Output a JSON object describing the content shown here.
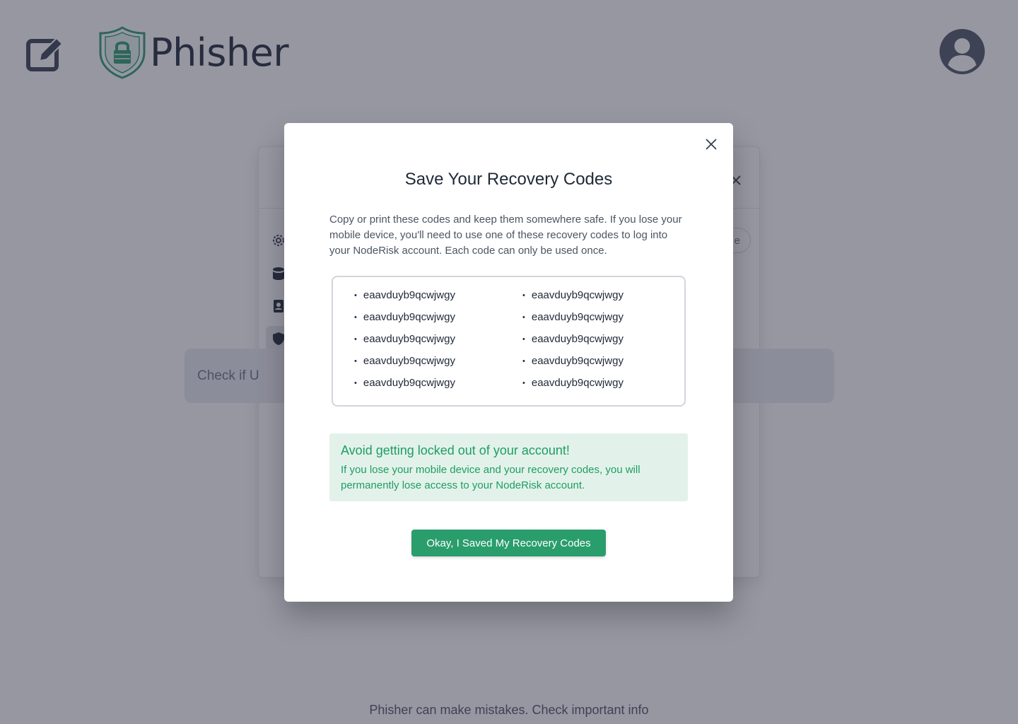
{
  "app": {
    "name": "Phisher",
    "footer_note": "Phisher can make mistakes. Check important info"
  },
  "colors": {
    "brand_green": "#2a9d6c",
    "alert_bg": "#e2f2ea",
    "alert_text": "#1f9d63",
    "overlay": "#303046"
  },
  "background": {
    "check_bar_text": "Check if U",
    "settings_pill_text": "e"
  },
  "modal": {
    "title": "Save Your Recovery Codes",
    "description": "Copy or print these codes and keep them somewhere safe. If you lose your mobile device, you'll need to use one of these recovery codes to log into your NodeRisk account. Each code can only be used once.",
    "codes": [
      "eaavduyb9qcwjwgy",
      "eaavduyb9qcwjwgy",
      "eaavduyb9qcwjwgy",
      "eaavduyb9qcwjwgy",
      "eaavduyb9qcwjwgy",
      "eaavduyb9qcwjwgy",
      "eaavduyb9qcwjwgy",
      "eaavduyb9qcwjwgy",
      "eaavduyb9qcwjwgy",
      "eaavduyb9qcwjwgy"
    ],
    "alert": {
      "title": "Avoid getting locked out of your account!",
      "body": "If you lose your mobile device and your recovery codes, you will permanently lose access to your NodeRisk account."
    },
    "confirm_label": "Okay, I Saved My Recovery Codes"
  },
  "icons": {
    "edit": "edit-icon",
    "logo": "shield-lock-icon",
    "avatar": "user-avatar-icon",
    "close": "close-icon",
    "settings_nav": [
      "gear-icon",
      "database-icon",
      "contact-icon",
      "shield-icon"
    ]
  }
}
